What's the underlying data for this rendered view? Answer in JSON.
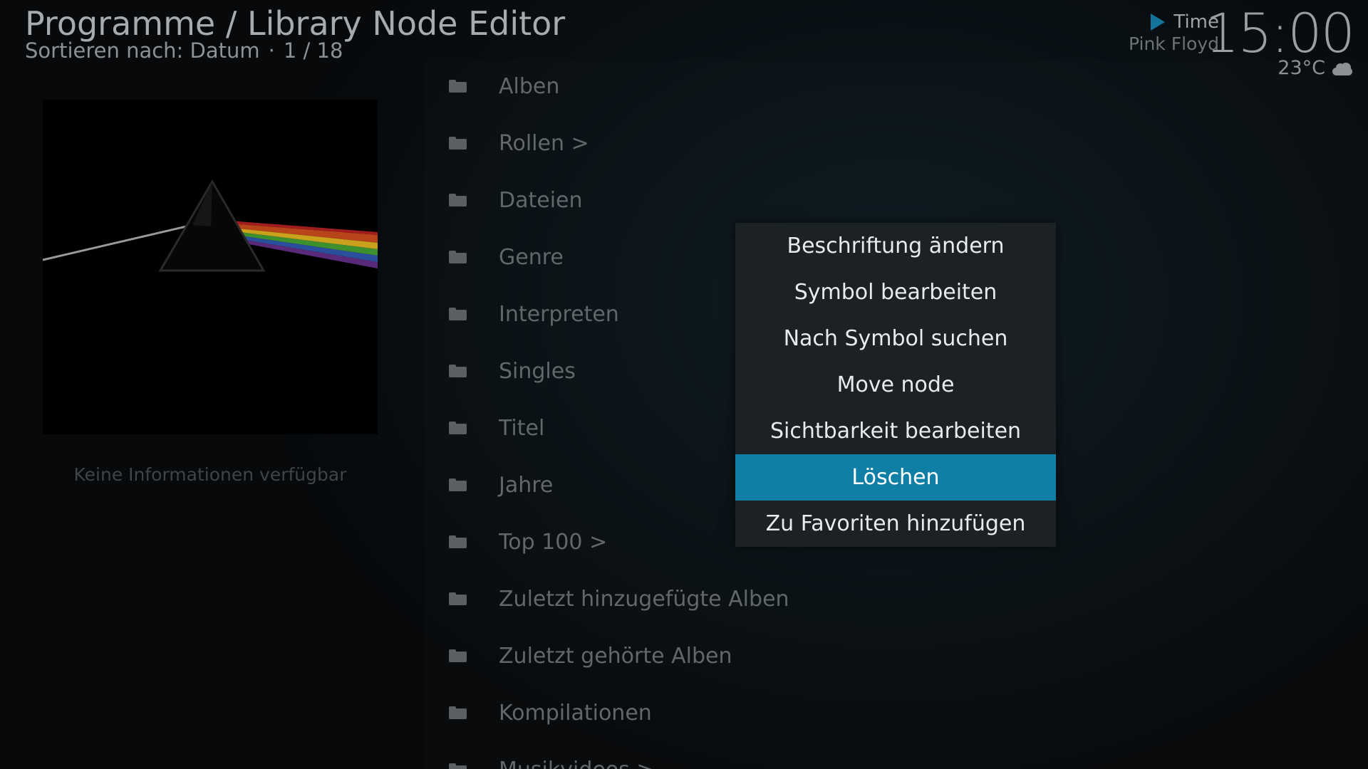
{
  "header": {
    "title": "Programme / Library Node Editor",
    "sort_label": "Sortieren nach: Datum",
    "separator": "·",
    "position": "1 / 18"
  },
  "now_playing": {
    "title": "Time",
    "artist": "Pink Floyd"
  },
  "clock": "15:00",
  "weather": {
    "temperature": "23°C",
    "icon": "cloud-icon"
  },
  "info_panel": {
    "no_info_text": "Keine Informationen verfügbar"
  },
  "list": {
    "items": [
      {
        "label": "Alben"
      },
      {
        "label": "Rollen >"
      },
      {
        "label": "Dateien"
      },
      {
        "label": "Genre"
      },
      {
        "label": "Interpreten"
      },
      {
        "label": "Singles"
      },
      {
        "label": "Titel"
      },
      {
        "label": "Jahre"
      },
      {
        "label": "Top 100 >"
      },
      {
        "label": "Zuletzt hinzugefügte Alben"
      },
      {
        "label": "Zuletzt gehörte Alben"
      },
      {
        "label": "Kompilationen"
      },
      {
        "label": "Musikvideos >"
      }
    ]
  },
  "context_menu": {
    "selected_index": 5,
    "items": [
      {
        "label": "Beschriftung ändern"
      },
      {
        "label": "Symbol bearbeiten"
      },
      {
        "label": "Nach Symbol suchen"
      },
      {
        "label": "Move node"
      },
      {
        "label": "Sichtbarkeit bearbeiten"
      },
      {
        "label": "Löschen"
      },
      {
        "label": "Zu Favoriten hinzufügen"
      }
    ]
  },
  "colors": {
    "accent": "#0f7fa5",
    "menu_bg": "#1c2125"
  }
}
